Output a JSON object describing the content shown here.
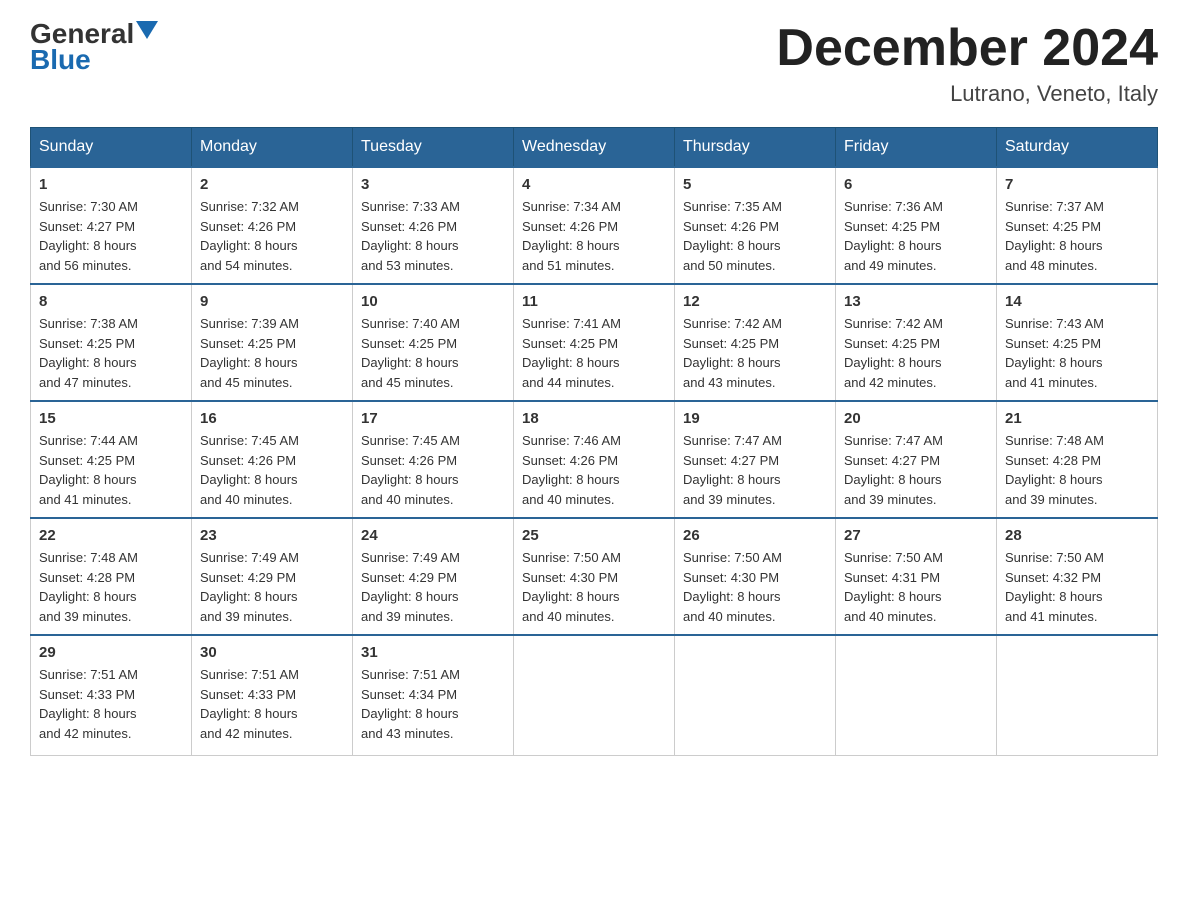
{
  "header": {
    "logo_general": "General",
    "logo_blue": "Blue",
    "month_title": "December 2024",
    "location": "Lutrano, Veneto, Italy"
  },
  "days_of_week": [
    "Sunday",
    "Monday",
    "Tuesday",
    "Wednesday",
    "Thursday",
    "Friday",
    "Saturday"
  ],
  "weeks": [
    [
      {
        "day": "1",
        "sunrise": "7:30 AM",
        "sunset": "4:27 PM",
        "daylight": "8 hours and 56 minutes."
      },
      {
        "day": "2",
        "sunrise": "7:32 AM",
        "sunset": "4:26 PM",
        "daylight": "8 hours and 54 minutes."
      },
      {
        "day": "3",
        "sunrise": "7:33 AM",
        "sunset": "4:26 PM",
        "daylight": "8 hours and 53 minutes."
      },
      {
        "day": "4",
        "sunrise": "7:34 AM",
        "sunset": "4:26 PM",
        "daylight": "8 hours and 51 minutes."
      },
      {
        "day": "5",
        "sunrise": "7:35 AM",
        "sunset": "4:26 PM",
        "daylight": "8 hours and 50 minutes."
      },
      {
        "day": "6",
        "sunrise": "7:36 AM",
        "sunset": "4:25 PM",
        "daylight": "8 hours and 49 minutes."
      },
      {
        "day": "7",
        "sunrise": "7:37 AM",
        "sunset": "4:25 PM",
        "daylight": "8 hours and 48 minutes."
      }
    ],
    [
      {
        "day": "8",
        "sunrise": "7:38 AM",
        "sunset": "4:25 PM",
        "daylight": "8 hours and 47 minutes."
      },
      {
        "day": "9",
        "sunrise": "7:39 AM",
        "sunset": "4:25 PM",
        "daylight": "8 hours and 45 minutes."
      },
      {
        "day": "10",
        "sunrise": "7:40 AM",
        "sunset": "4:25 PM",
        "daylight": "8 hours and 45 minutes."
      },
      {
        "day": "11",
        "sunrise": "7:41 AM",
        "sunset": "4:25 PM",
        "daylight": "8 hours and 44 minutes."
      },
      {
        "day": "12",
        "sunrise": "7:42 AM",
        "sunset": "4:25 PM",
        "daylight": "8 hours and 43 minutes."
      },
      {
        "day": "13",
        "sunrise": "7:42 AM",
        "sunset": "4:25 PM",
        "daylight": "8 hours and 42 minutes."
      },
      {
        "day": "14",
        "sunrise": "7:43 AM",
        "sunset": "4:25 PM",
        "daylight": "8 hours and 41 minutes."
      }
    ],
    [
      {
        "day": "15",
        "sunrise": "7:44 AM",
        "sunset": "4:25 PM",
        "daylight": "8 hours and 41 minutes."
      },
      {
        "day": "16",
        "sunrise": "7:45 AM",
        "sunset": "4:26 PM",
        "daylight": "8 hours and 40 minutes."
      },
      {
        "day": "17",
        "sunrise": "7:45 AM",
        "sunset": "4:26 PM",
        "daylight": "8 hours and 40 minutes."
      },
      {
        "day": "18",
        "sunrise": "7:46 AM",
        "sunset": "4:26 PM",
        "daylight": "8 hours and 40 minutes."
      },
      {
        "day": "19",
        "sunrise": "7:47 AM",
        "sunset": "4:27 PM",
        "daylight": "8 hours and 39 minutes."
      },
      {
        "day": "20",
        "sunrise": "7:47 AM",
        "sunset": "4:27 PM",
        "daylight": "8 hours and 39 minutes."
      },
      {
        "day": "21",
        "sunrise": "7:48 AM",
        "sunset": "4:28 PM",
        "daylight": "8 hours and 39 minutes."
      }
    ],
    [
      {
        "day": "22",
        "sunrise": "7:48 AM",
        "sunset": "4:28 PM",
        "daylight": "8 hours and 39 minutes."
      },
      {
        "day": "23",
        "sunrise": "7:49 AM",
        "sunset": "4:29 PM",
        "daylight": "8 hours and 39 minutes."
      },
      {
        "day": "24",
        "sunrise": "7:49 AM",
        "sunset": "4:29 PM",
        "daylight": "8 hours and 39 minutes."
      },
      {
        "day": "25",
        "sunrise": "7:50 AM",
        "sunset": "4:30 PM",
        "daylight": "8 hours and 40 minutes."
      },
      {
        "day": "26",
        "sunrise": "7:50 AM",
        "sunset": "4:30 PM",
        "daylight": "8 hours and 40 minutes."
      },
      {
        "day": "27",
        "sunrise": "7:50 AM",
        "sunset": "4:31 PM",
        "daylight": "8 hours and 40 minutes."
      },
      {
        "day": "28",
        "sunrise": "7:50 AM",
        "sunset": "4:32 PM",
        "daylight": "8 hours and 41 minutes."
      }
    ],
    [
      {
        "day": "29",
        "sunrise": "7:51 AM",
        "sunset": "4:33 PM",
        "daylight": "8 hours and 42 minutes."
      },
      {
        "day": "30",
        "sunrise": "7:51 AM",
        "sunset": "4:33 PM",
        "daylight": "8 hours and 42 minutes."
      },
      {
        "day": "31",
        "sunrise": "7:51 AM",
        "sunset": "4:34 PM",
        "daylight": "8 hours and 43 minutes."
      },
      {
        "day": "",
        "sunrise": "",
        "sunset": "",
        "daylight": ""
      },
      {
        "day": "",
        "sunrise": "",
        "sunset": "",
        "daylight": ""
      },
      {
        "day": "",
        "sunrise": "",
        "sunset": "",
        "daylight": ""
      },
      {
        "day": "",
        "sunrise": "",
        "sunset": "",
        "daylight": ""
      }
    ]
  ],
  "labels": {
    "sunrise": "Sunrise:",
    "sunset": "Sunset:",
    "daylight": "Daylight:"
  }
}
